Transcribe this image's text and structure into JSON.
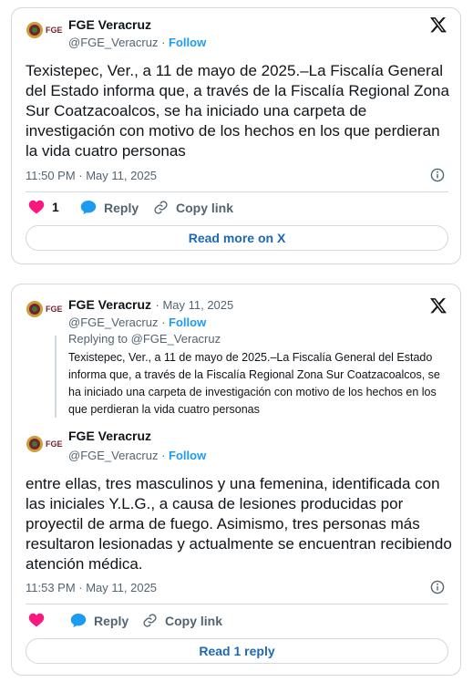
{
  "tweet1": {
    "account": {
      "name": "FGE Veracruz",
      "handle": "@FGE_Veracruz",
      "separator": "·",
      "follow": "Follow"
    },
    "text": "Texistepec, Ver., a 11 de mayo de 2025.–La Fiscalía General del Estado informa que, a través de la Fiscalía Regional Zona Sur Coatzacoalcos, se ha iniciado una carpeta de investigación con motivo de los hechos en los que perdieran la vida cuatro personas",
    "timestamp": "11:50 PM · May 11, 2025",
    "likes": "1",
    "reply_label": "Reply",
    "copy_label": "Copy link",
    "cta": "Read more on X"
  },
  "tweet2": {
    "parent": {
      "name": "FGE Veracruz",
      "date": "· May 11, 2025",
      "handle": "@FGE_Veracruz",
      "separator": "·",
      "follow": "Follow",
      "replying_to": "Replying to @FGE_Veracruz",
      "text": "Texistepec, Ver., a 11 de mayo de 2025.–La Fiscalía General del Estado informa que, a través de la Fiscalía Regional Zona Sur Coatzacoalcos, se ha iniciado una carpeta de investigación con motivo de los hechos en los que perdieran la vida cuatro personas"
    },
    "account": {
      "name": "FGE Veracruz",
      "handle": "@FGE_Veracruz",
      "separator": "·",
      "follow": "Follow"
    },
    "text": "entre ellas, tres masculinos y una femenina, identificada con las iniciales Y.L.G., a causa de lesiones producidas por proyectil de arma de fuego. Asimismo, tres personas más resultaron lesionadas y actualmente se encuentran recibiendo atención médica.",
    "timestamp": "11:53 PM · May 11, 2025",
    "reply_label": "Reply",
    "copy_label": "Copy link",
    "cta": "Read 1 reply"
  },
  "logo_text": "FGE",
  "colors": {
    "like": "#f91880",
    "accent": "#1d9bf0",
    "cta": "#1d68b6",
    "border": "#cfd9de",
    "secondary": "#536471"
  },
  "icons": [
    "fge-seal-logo",
    "x-logo-icon",
    "info-icon",
    "heart-icon",
    "reply-bubble-icon",
    "link-icon"
  ]
}
